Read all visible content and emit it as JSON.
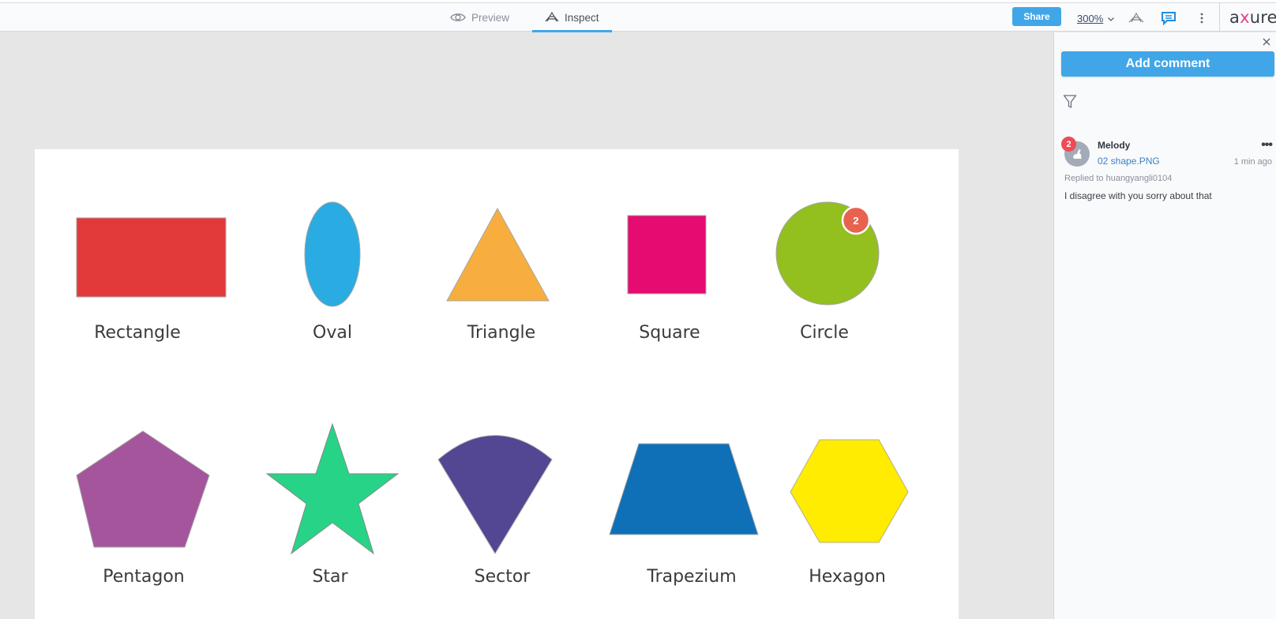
{
  "header": {
    "tabs": [
      {
        "label": "Preview",
        "icon": "eye-icon",
        "active": false
      },
      {
        "label": "Inspect",
        "icon": "inspect-icon",
        "active": true
      }
    ],
    "share_label": "Share",
    "zoom_level": "300%",
    "logo": {
      "left": "a",
      "x": "x",
      "right": "ure"
    },
    "accent_color": "#41a6e8"
  },
  "canvas": {
    "shapes": [
      {
        "name": "Rectangle",
        "color": "#e23a3a"
      },
      {
        "name": "Oval",
        "color": "#2aabe2"
      },
      {
        "name": "Triangle",
        "color": "#f7ae3e"
      },
      {
        "name": "Square",
        "color": "#e50b70"
      },
      {
        "name": "Circle",
        "color": "#93bf1f"
      },
      {
        "name": "Pentagon",
        "color": "#a4559b"
      },
      {
        "name": "Star",
        "color": "#27d386"
      },
      {
        "name": "Sector",
        "color": "#534693"
      },
      {
        "name": "Trapezium",
        "color": "#0f70b7"
      },
      {
        "name": "Hexagon",
        "color": "#ffec00"
      }
    ],
    "pin_badge": {
      "count": "2",
      "color": "#e8634f"
    }
  },
  "panel": {
    "add_comment_label": "Add comment",
    "comments": [
      {
        "badge": "2",
        "author": "Melody",
        "file": "02 shape.PNG",
        "time": "1 min ago",
        "replied_to": "Replied to huangyangli0104",
        "text": "I disagree with you sorry about that"
      }
    ]
  }
}
